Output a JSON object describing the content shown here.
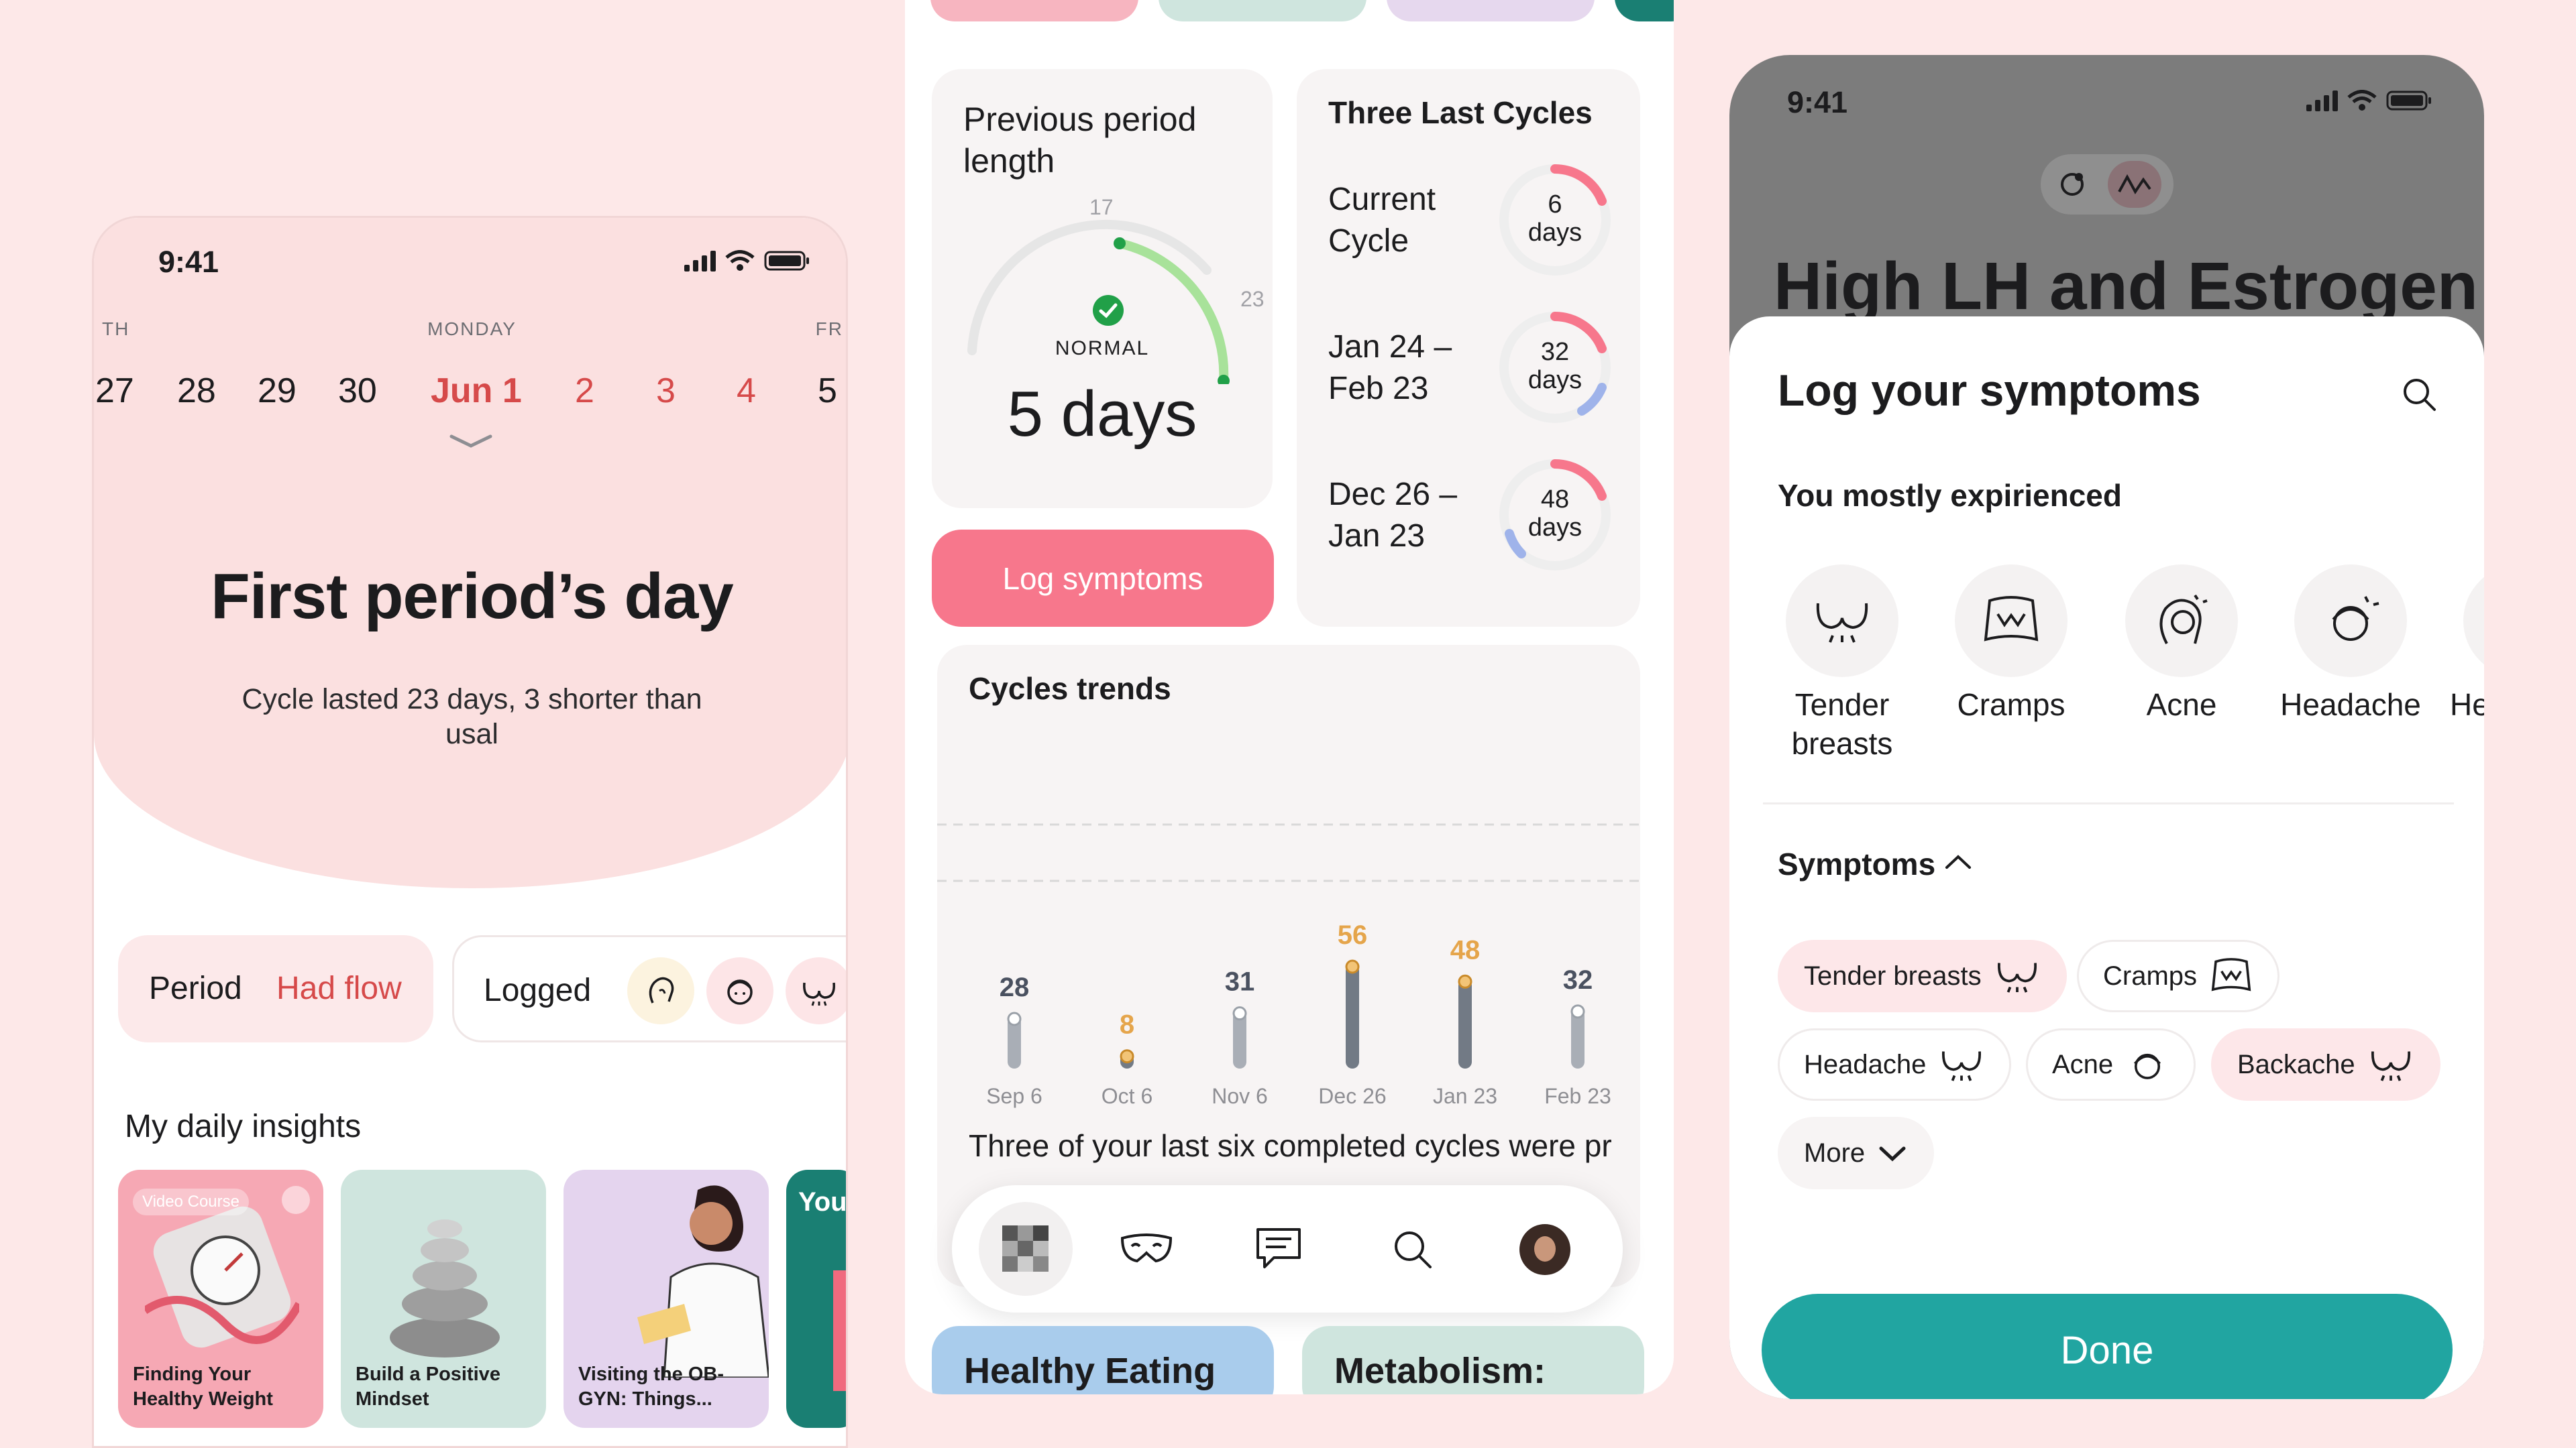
{
  "colors": {
    "pink": "#f7778c",
    "teal": "#21a5a1",
    "red": "#d64a4a",
    "bar_dark": "#727a85",
    "bar_light": "#a9aeb6",
    "accent_yellow": "#e5a54b"
  },
  "phone1": {
    "time": "9:41",
    "weekdays": {
      "left": "TH",
      "center": "MONDAY",
      "right": "FR"
    },
    "dates": [
      "27",
      "28",
      "29",
      "30",
      "Jun 1",
      "2",
      "3",
      "4",
      "5"
    ],
    "title": "First period’s day",
    "subtitle": "Cycle lasted 23 days, 3 shorter than usal",
    "chip_period": {
      "label": "Period",
      "value": "Had flow"
    },
    "chip_logged": {
      "label": "Logged",
      "icons": [
        "acne-icon",
        "headache-icon",
        "tender-breasts-icon"
      ]
    },
    "insights_title": "My daily insights",
    "insights": [
      {
        "badge": "Video Course",
        "caption": "Finding Your Healthy Weight",
        "icon": "scale-icon"
      },
      {
        "caption": "Build a Positive Mindset",
        "icon": "stones-icon"
      },
      {
        "caption": "Visiting the OB-GYN: Things...",
        "icon": "doctor-icon"
      },
      {
        "caption": "Your Cyc"
      }
    ]
  },
  "phone2": {
    "prev_period": {
      "title": "Previous period length",
      "scale_min": "17",
      "scale_max": "23",
      "status": "NORMAL",
      "value": "5 days"
    },
    "log_button": "Log symptoms",
    "three_cycles": {
      "title": "Three Last Cycles",
      "rows": [
        {
          "label": "Current Cycle",
          "num": "6",
          "unit": "days",
          "progress": 0.25
        },
        {
          "label": "Jan 24 – Feb 23",
          "num": "32",
          "unit": "days",
          "progress": 0.25
        },
        {
          "label": "Dec 26 – Jan 23",
          "num": "48",
          "unit": "days",
          "progress": 0.25
        }
      ]
    },
    "trends_title": "Cycles trends",
    "trends_text": "Three of your last six completed cycles were pr",
    "bottom_cards": [
      "Healthy Eating",
      "Metabolism:"
    ],
    "nav": [
      "app-tile-icon",
      "mask-icon",
      "chat-icon",
      "search-icon",
      "profile-avatar"
    ]
  },
  "chart_data": {
    "type": "bar",
    "title": "Cycles trends",
    "categories": [
      "Sep 6",
      "Oct 6",
      "Nov 6",
      "Dec 26",
      "Jan 23",
      "Feb 23"
    ],
    "values": [
      28,
      8,
      31,
      56,
      48,
      32
    ],
    "highlight": [
      false,
      true,
      false,
      true,
      true,
      false
    ],
    "ylim": [
      0,
      60
    ],
    "grid": "dashed reference lines"
  },
  "phone3": {
    "time": "9:41",
    "bg_heading": "High LH and Estrogen",
    "sheet_title": "Log your symptoms",
    "mostly_title": "You mostly expirienced",
    "mostly": [
      {
        "label": "Tender breasts",
        "icon": "tender-breasts-icon"
      },
      {
        "label": "Cramps",
        "icon": "cramps-icon"
      },
      {
        "label": "Acne",
        "icon": "acne-icon"
      },
      {
        "label": "Headache",
        "icon": "headache-icon"
      },
      {
        "label": "He",
        "icon": "headache-icon"
      }
    ],
    "symptoms_title": "Symptoms",
    "pills": [
      {
        "label": "Tender breasts",
        "selected": true
      },
      {
        "label": "Cramps",
        "selected": false
      },
      {
        "label": "Headache",
        "selected": false
      },
      {
        "label": "Acne",
        "selected": false
      },
      {
        "label": "Backache",
        "selected": true
      }
    ],
    "more": "More",
    "done": "Done"
  }
}
